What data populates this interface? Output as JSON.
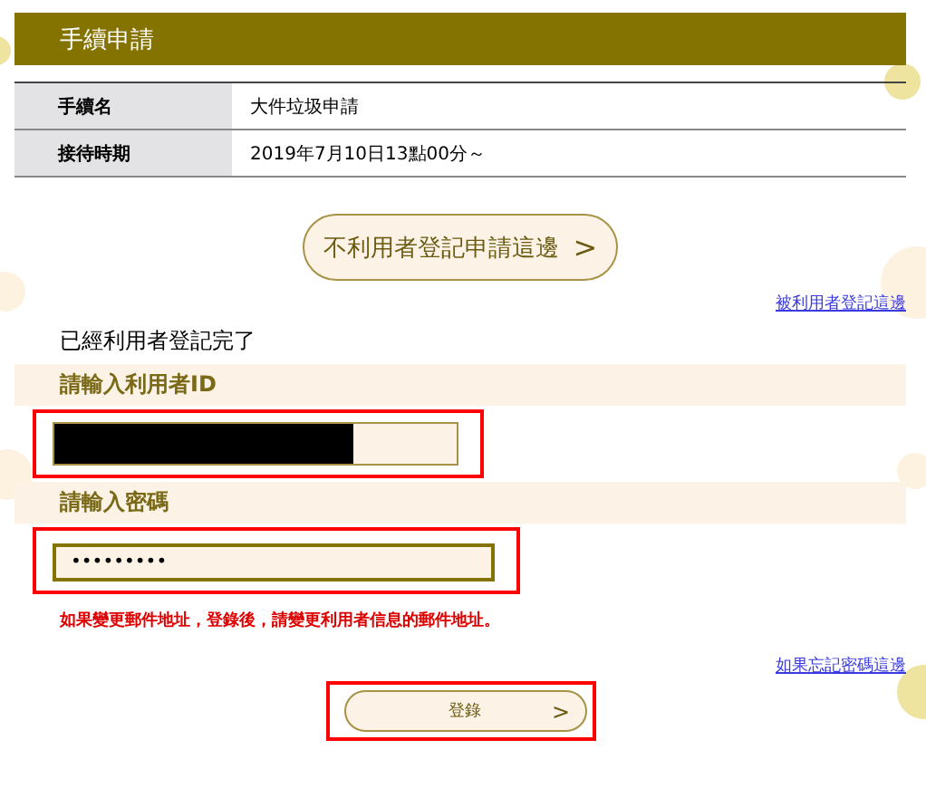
{
  "section_title": "手續申請",
  "details": [
    {
      "label": "手續名",
      "value": "大件垃圾申請"
    },
    {
      "label": "接待時期",
      "value": "2019年7月10日13點00分～"
    }
  ],
  "unregistered_button": {
    "label": "不利用者登記申請這邊",
    "arrow": ">"
  },
  "registered_link": "被利用者登記這邊",
  "status_text": "已經利用者登記完了",
  "id_section": {
    "label": "請輸入利用者ID",
    "redacted": true,
    "highlighted": true
  },
  "password_section": {
    "label": "請輸入密碼",
    "value": "•••••••••",
    "highlighted": true
  },
  "notice": "如果變更郵件地址，登錄後，請變更利用者信息的郵件地址。",
  "forgot_link": "如果忘記密碼這邊",
  "login_button": {
    "label": "登錄",
    "arrow": ">",
    "highlighted": true
  }
}
